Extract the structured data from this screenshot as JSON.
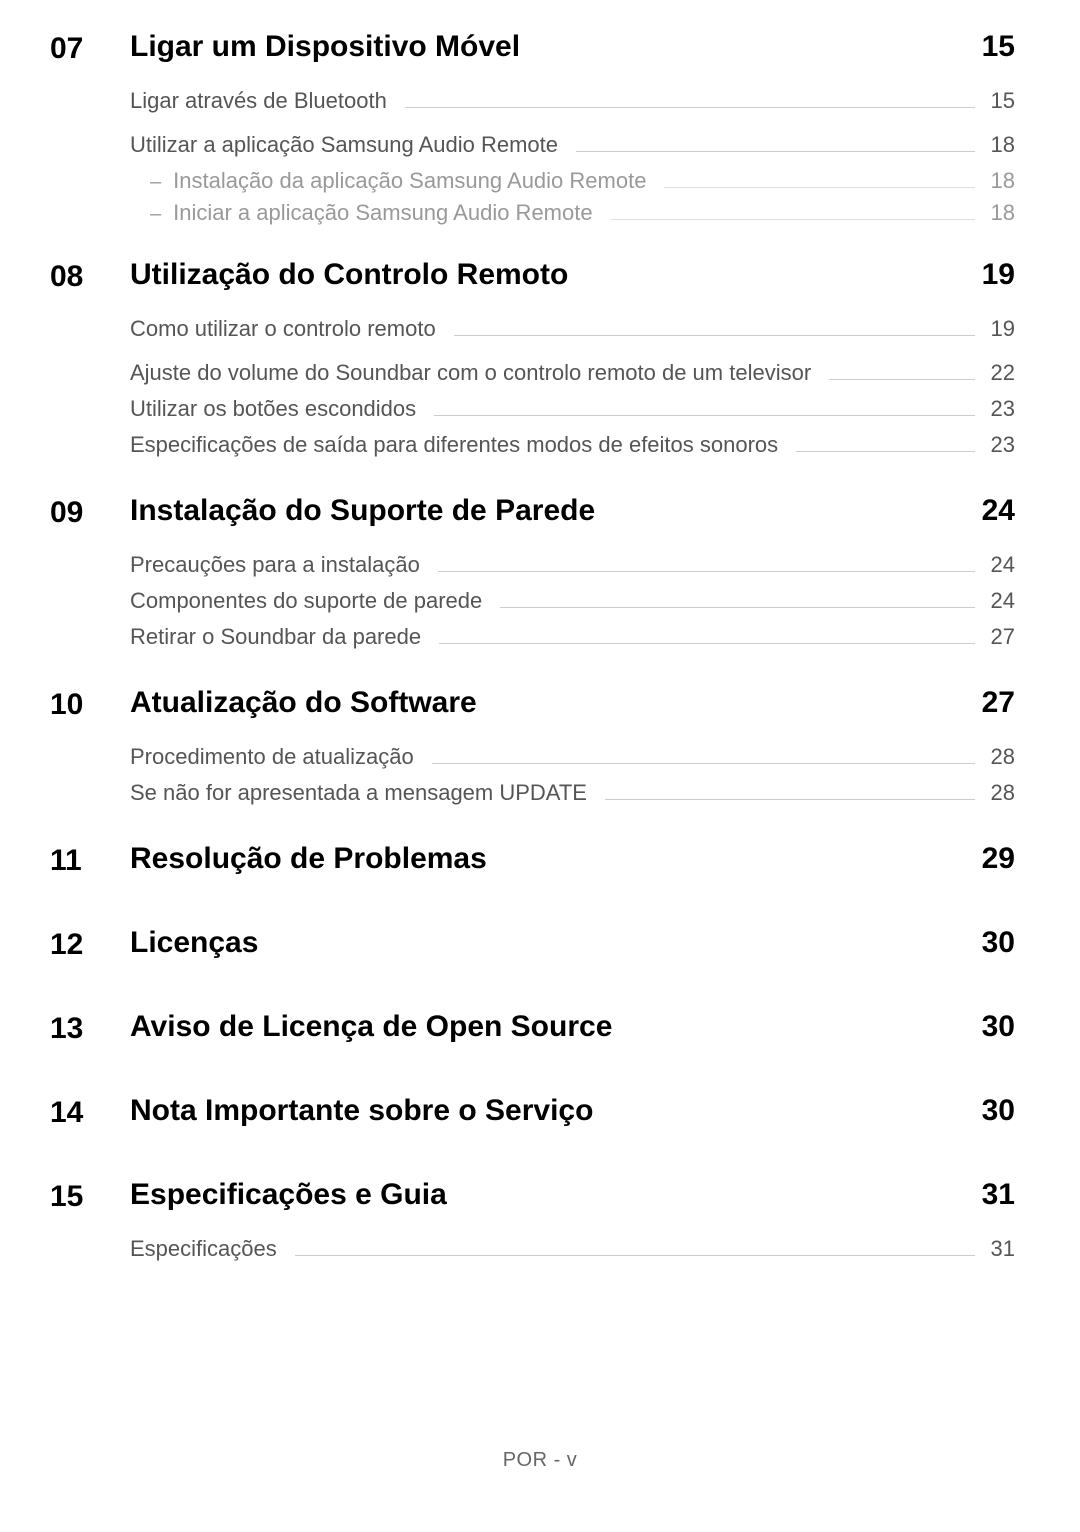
{
  "footer": "POR - v",
  "sections": [
    {
      "num": "07",
      "title": "Ligar um Dispositivo Móvel",
      "page": "15",
      "entries": [
        {
          "text": "Ligar através de Bluetooth",
          "page": "15",
          "gapAfter": true
        },
        {
          "text": "Utilizar a aplicação Samsung Audio Remote",
          "page": "18",
          "subs": [
            {
              "text": "Instalação da aplicação Samsung Audio Remote",
              "page": "18"
            },
            {
              "text": "Iniciar a aplicação Samsung Audio Remote",
              "page": "18"
            }
          ]
        }
      ]
    },
    {
      "num": "08",
      "title": "Utilização do Controlo Remoto",
      "page": "19",
      "entries": [
        {
          "text": "Como utilizar o controlo remoto",
          "page": "19",
          "gapAfter": true
        },
        {
          "text": "Ajuste do volume do Soundbar com o controlo remoto de um televisor",
          "page": "22"
        },
        {
          "text": "Utilizar os botões escondidos",
          "page": "23"
        },
        {
          "text": "Especificações de saída para diferentes modos de efeitos sonoros",
          "page": "23"
        }
      ]
    },
    {
      "num": "09",
      "title": "Instalação do Suporte de Parede",
      "page": "24",
      "entries": [
        {
          "text": "Precauções para a instalação",
          "page": "24"
        },
        {
          "text": "Componentes do suporte de parede",
          "page": "24"
        },
        {
          "text": "Retirar o Soundbar da parede",
          "page": "27"
        }
      ]
    },
    {
      "num": "10",
      "title": "Atualização do Software",
      "page": "27",
      "entries": [
        {
          "text": "Procedimento de atualização",
          "page": "28"
        },
        {
          "text": "Se não for apresentada a mensagem UPDATE",
          "page": "28"
        }
      ]
    },
    {
      "num": "11",
      "title": "Resolução de Problemas",
      "page": "29",
      "entries": []
    },
    {
      "num": "12",
      "title": "Licenças",
      "page": "30",
      "entries": []
    },
    {
      "num": "13",
      "title": "Aviso de Licença de Open Source",
      "page": "30",
      "entries": []
    },
    {
      "num": "14",
      "title": "Nota Importante sobre o Serviço",
      "page": "30",
      "entries": []
    },
    {
      "num": "15",
      "title": "Especificações e Guia",
      "page": "31",
      "entries": [
        {
          "text": "Especificações",
          "page": "31"
        }
      ]
    }
  ]
}
